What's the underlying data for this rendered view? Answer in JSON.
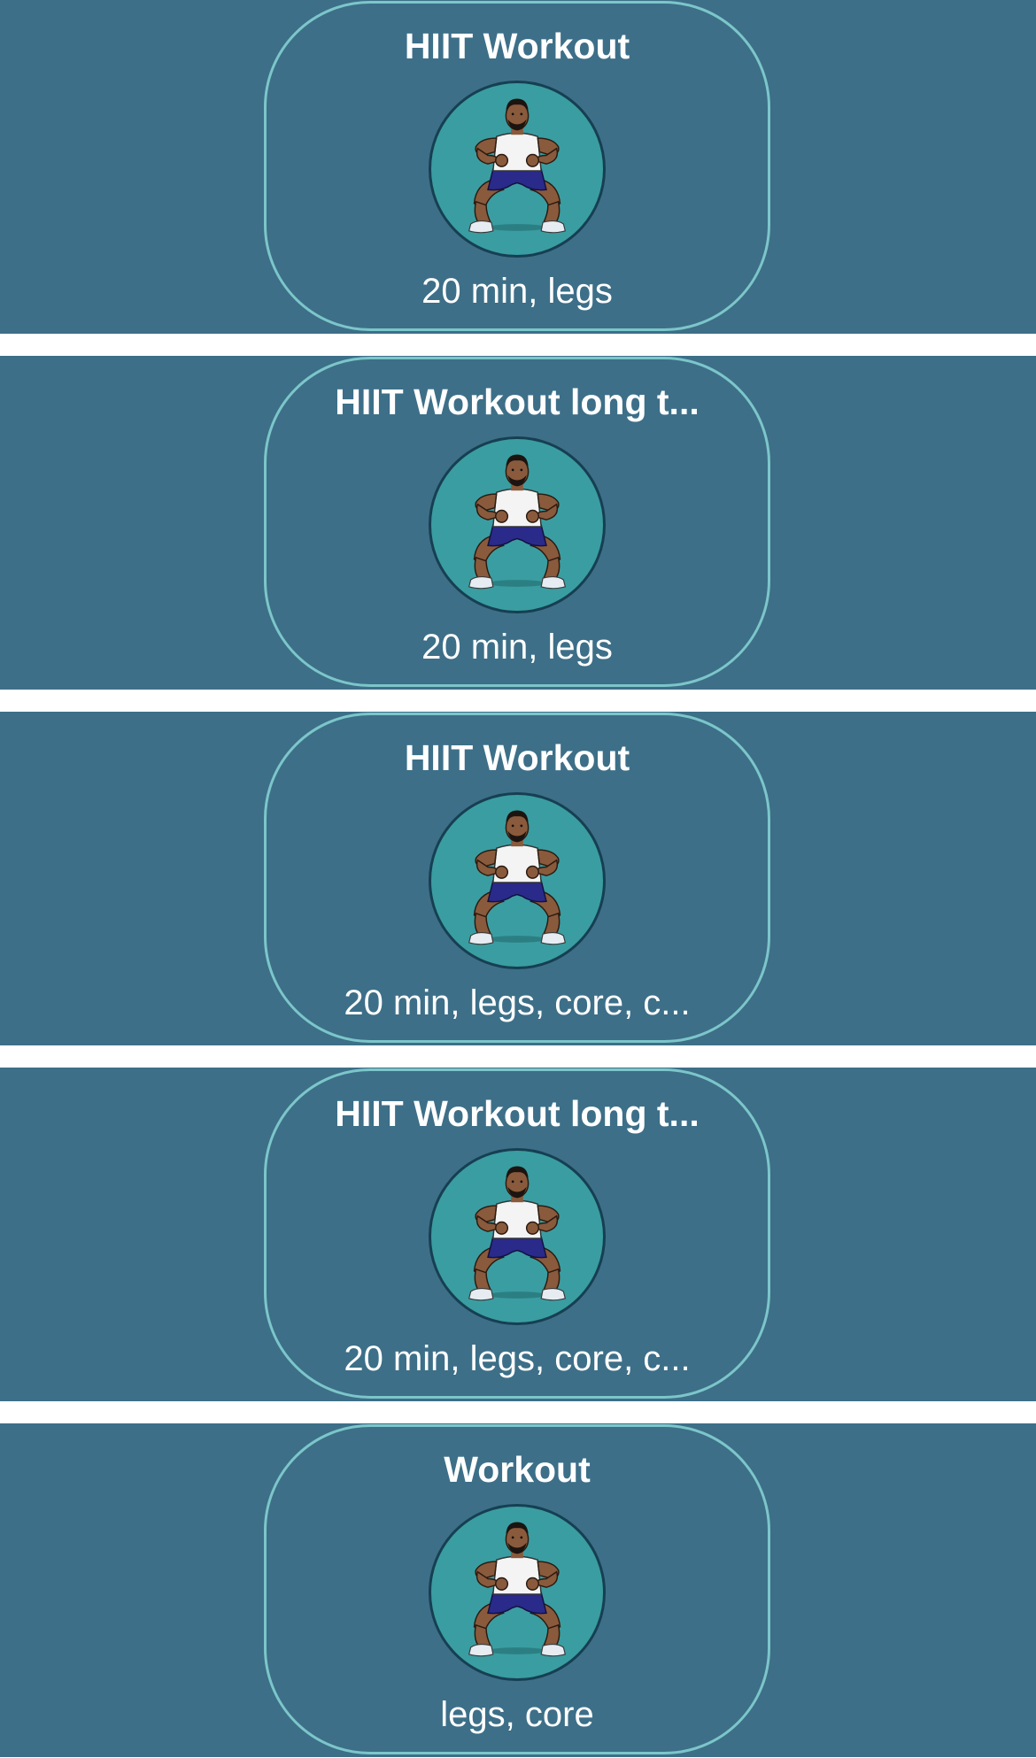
{
  "colors": {
    "row_background": "#3d6f88",
    "card_border": "#7cc6ca",
    "avatar_background": "#3a9da1",
    "avatar_ring": "#163f52",
    "separator": "#ffffff",
    "text": "#ffffff"
  },
  "workouts": [
    {
      "title": "HIIT Workout",
      "subtitle": "20 min, legs",
      "icon": "squat-athlete-avatar"
    },
    {
      "title": "HIIT Workout long t...",
      "subtitle": "20 min, legs",
      "icon": "squat-athlete-avatar"
    },
    {
      "title": "HIIT Workout",
      "subtitle": "20 min, legs, core, c...",
      "icon": "squat-athlete-avatar"
    },
    {
      "title": "HIIT Workout long t...",
      "subtitle": "20 min, legs, core, c...",
      "icon": "squat-athlete-avatar"
    },
    {
      "title": "Workout",
      "subtitle": "legs, core",
      "icon": "squat-athlete-avatar"
    }
  ]
}
